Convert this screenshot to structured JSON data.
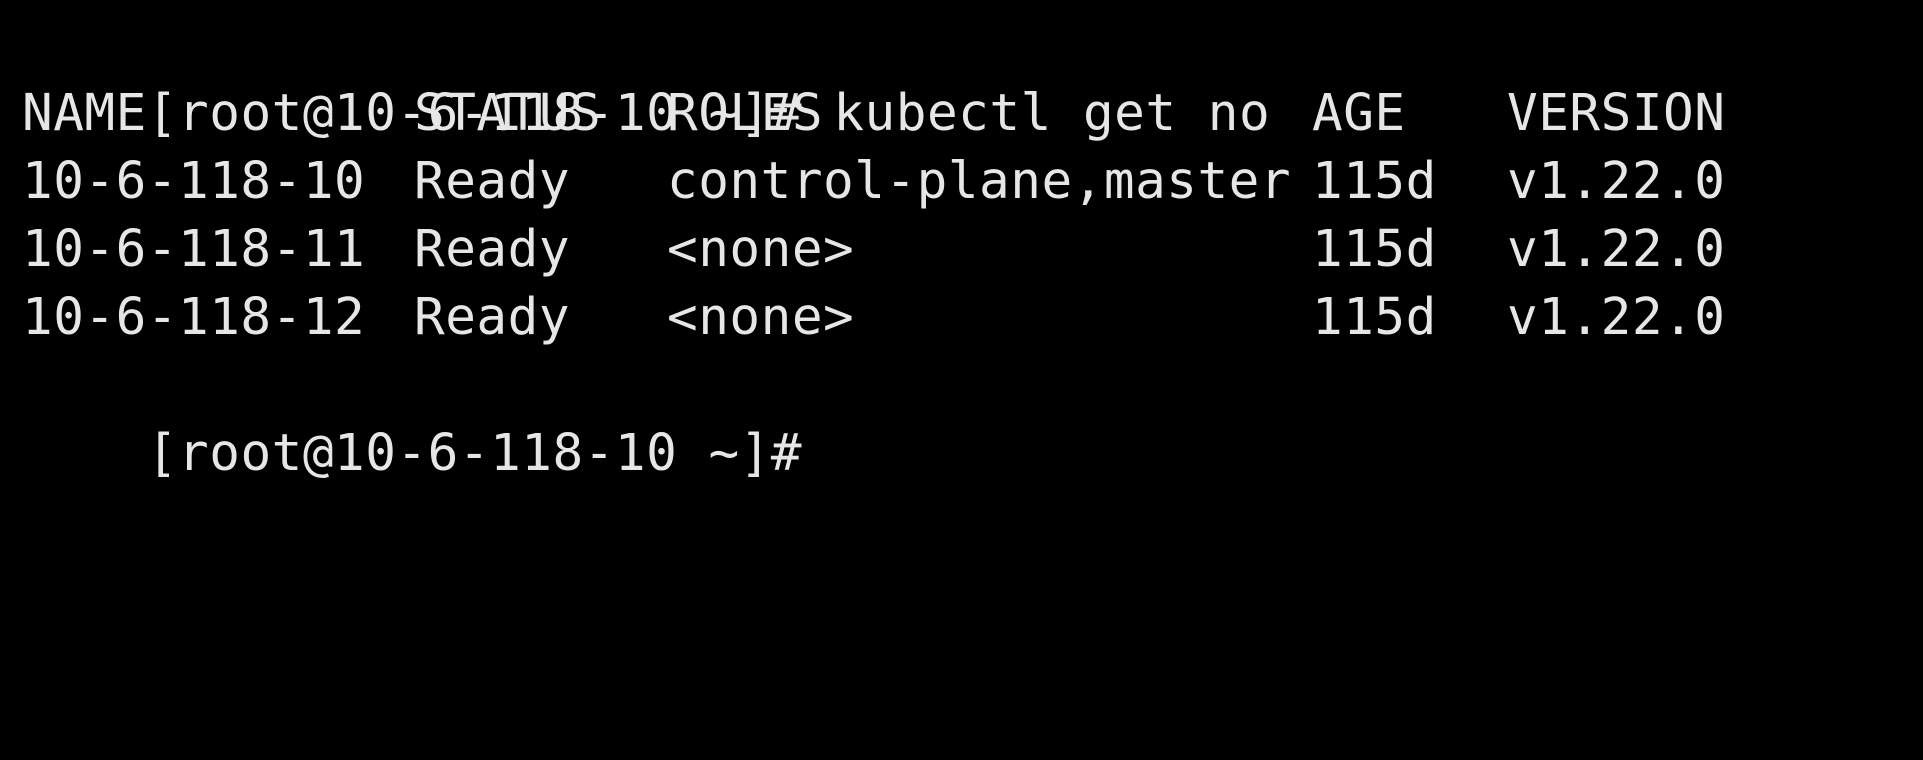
{
  "terminal": {
    "background": "#000000",
    "foreground": "#e6e6e6",
    "partial_line": "[                                  ",
    "prompt": "[root@10-6-118-10 ~]#",
    "command": "kubectl get no",
    "final_prompt": "[root@10-6-118-10 ~]#"
  },
  "table": {
    "headers": {
      "name": "NAME",
      "status": "STATUS",
      "roles": "ROLES",
      "age": "AGE",
      "version": "VERSION"
    },
    "rows": [
      {
        "name": "10-6-118-10",
        "status": "Ready",
        "roles": "control-plane,master",
        "age": "115d",
        "version": "v1.22.0"
      },
      {
        "name": "10-6-118-11",
        "status": "Ready",
        "roles": "<none>",
        "age": "115d",
        "version": "v1.22.0"
      },
      {
        "name": "10-6-118-12",
        "status": "Ready",
        "roles": "<none>",
        "age": "115d",
        "version": "v1.22.0"
      }
    ]
  }
}
